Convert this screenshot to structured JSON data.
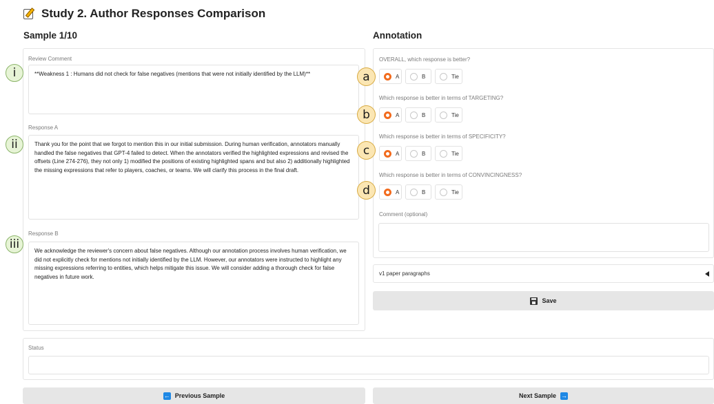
{
  "page": {
    "title": "Study 2. Author Responses Comparison"
  },
  "sample": {
    "heading": "Sample 1/10",
    "review_label": "Review Comment",
    "review_text": "**Weakness 1 : Humans did not check for false negatives (mentions that were not initially identified by the LLM)**",
    "response_a_label": "Response A",
    "response_a_text": "Thank you for the point that we forgot to mention this in our initial submission. During human verification, annotators manually handled the false negatives that GPT-4 failed to detect. When the annotators verified the highlighted expressions and revised the offsets (Line 274-276), they not only 1) modified the positions of existing highlighted spans and but also 2) additionally highlighted the missing expressions that refer to players, coaches, or teams. We will clarify this process in the final draft.",
    "response_b_label": "Response B",
    "response_b_text": "We acknowledge the reviewer's concern about false negatives. Although our annotation process involves human verification, we did not explicitly check for mentions not initially identified by the LLM. However, our annotators were instructed to highlight any missing expressions referring to entities, which helps mitigate this issue. We will consider adding a thorough check for false negatives in future work."
  },
  "annotation": {
    "heading": "Annotation",
    "questions": [
      {
        "label": "OVERALL, which response is better?",
        "selected": "A"
      },
      {
        "label": "Which response is better in terms of TARGETING?",
        "selected": "A"
      },
      {
        "label": "Which response is better in terms of SPECIFICITY?",
        "selected": "A"
      },
      {
        "label": "Which response is better in terms of CONVINCINGNESS?",
        "selected": "A"
      }
    ],
    "options": [
      "A",
      "B",
      "Tie"
    ],
    "comment_label": "Comment (optional)",
    "comment_value": "",
    "accordion_label": "v1 paper paragraphs",
    "save_label": "Save"
  },
  "status": {
    "label": "Status",
    "value": ""
  },
  "nav": {
    "prev_label": "Previous Sample",
    "next_label": "Next Sample"
  },
  "markers": {
    "left": [
      "i",
      "ii",
      "iii"
    ],
    "right": [
      "a",
      "b",
      "c",
      "d"
    ]
  },
  "colors": {
    "accent_radio": "#f26b1d",
    "marker_green_fill": "#e7f4d6",
    "marker_yellow_fill": "#fbe6b3",
    "nav_arrow": "#1e88e5"
  }
}
